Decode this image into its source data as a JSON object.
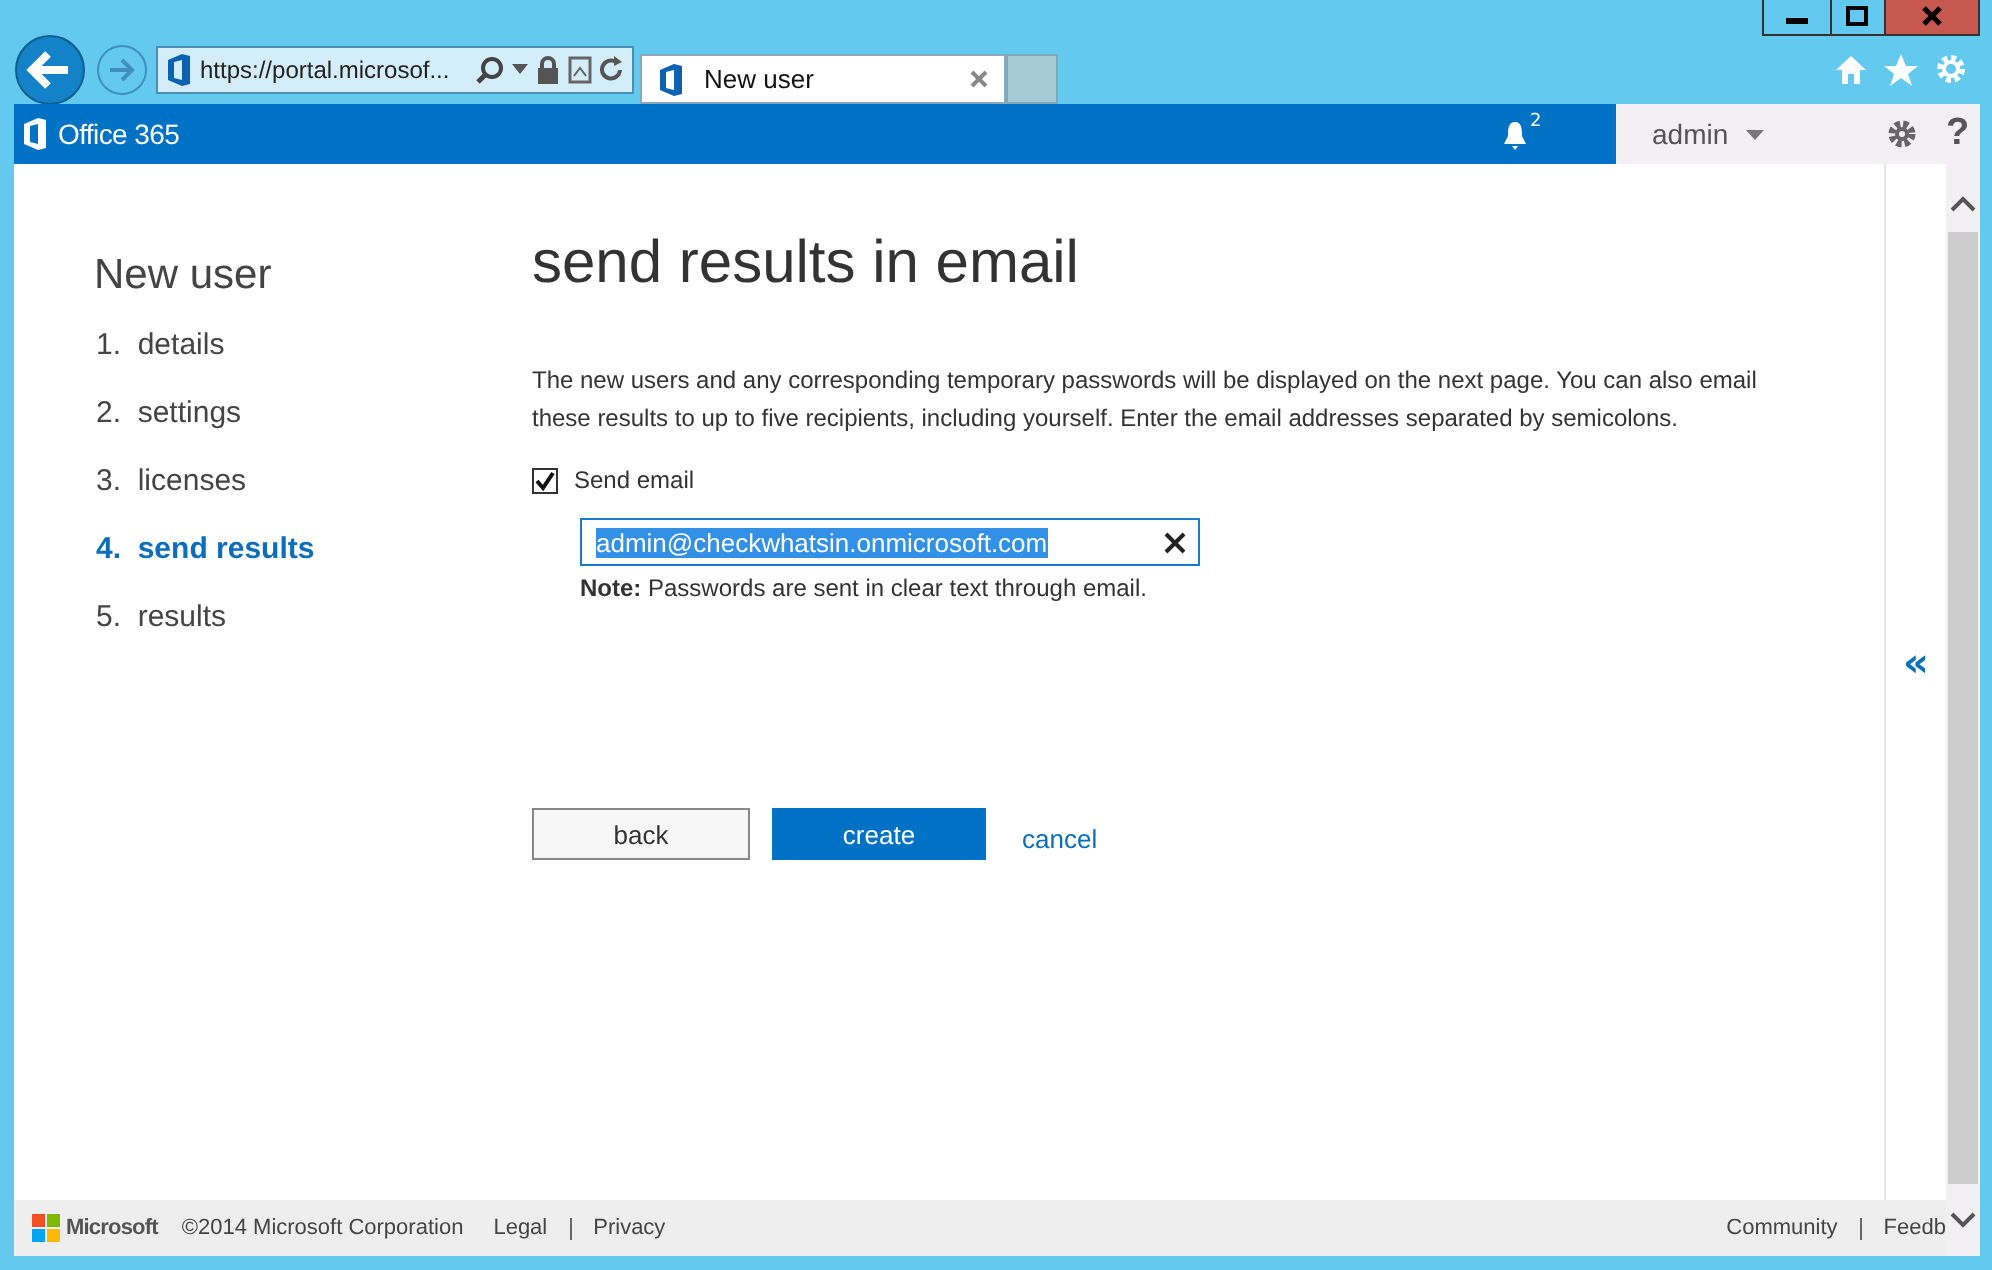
{
  "browser": {
    "address": "https://portal.microsof...",
    "tab_title": "New user"
  },
  "header": {
    "product": "Office 365",
    "notification_count": "2",
    "user": "admin",
    "help": "?"
  },
  "wizard": {
    "title": "New user",
    "steps": [
      {
        "number": "1.",
        "label": "details",
        "selected": false
      },
      {
        "number": "2.",
        "label": "settings",
        "selected": false
      },
      {
        "number": "3.",
        "label": "licenses",
        "selected": false
      },
      {
        "number": "4.",
        "label": "send results",
        "selected": true
      },
      {
        "number": "5.",
        "label": "results",
        "selected": false
      }
    ]
  },
  "content": {
    "heading": "send results in email",
    "description": "The new users and any corresponding temporary passwords will be displayed on the next page. You can also email these results to up to five recipients, including yourself. Enter the email addresses separated by semicolons.",
    "send_email": {
      "label": "Send email",
      "checked": true
    },
    "email_field": {
      "value": "admin@checkwhatsin.onmicrosoft.com",
      "selected": true
    },
    "note": "**Note:** Passwords are sent in clear text through email.",
    "buttons": [
      {
        "label": "back",
        "kind": "secondary"
      },
      {
        "label": "create",
        "kind": "primary"
      },
      {
        "label": "cancel",
        "kind": "link"
      }
    ]
  },
  "side_panel": {
    "toggle": "«"
  },
  "footer": {
    "company": "Microsoft",
    "copyright": "©2014 Microsoft Corporation",
    "left_links": [
      "Legal",
      "Privacy"
    ],
    "right_links": [
      "Community",
      "Feedb"
    ]
  }
}
